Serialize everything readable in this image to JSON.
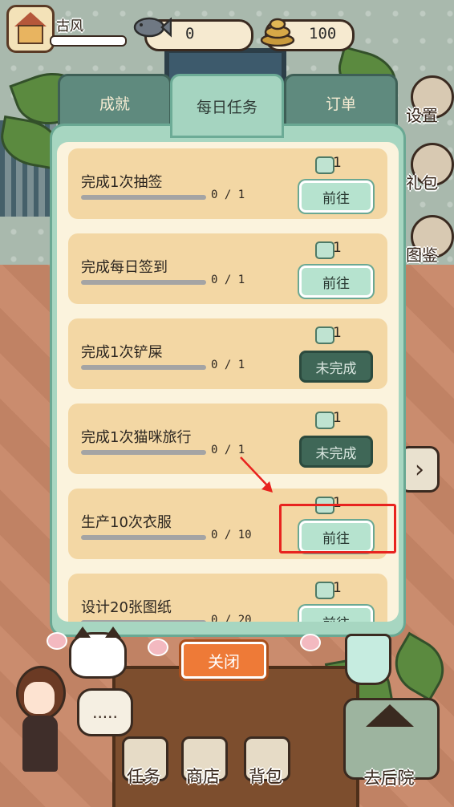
{
  "hud": {
    "player_name": "古风",
    "fish_count": "0",
    "coin_count": "100",
    "fish_icon": "fish-icon",
    "coin_icon": "poop-coin-icon"
  },
  "side_menu": {
    "settings": "设置",
    "gift": "礼包",
    "collection": "图鉴",
    "next_icon": "chevron-right-icon"
  },
  "tabs": [
    {
      "label": "成就",
      "active": false
    },
    {
      "label": "每日任务",
      "active": true
    },
    {
      "label": "订单",
      "active": false
    }
  ],
  "tasks": [
    {
      "title": "完成1次抽签",
      "progress": "0 / 1",
      "reward": "1",
      "button": "前往",
      "state": "go"
    },
    {
      "title": "完成每日签到",
      "progress": "0 / 1",
      "reward": "1",
      "button": "前往",
      "state": "go"
    },
    {
      "title": "完成1次铲屎",
      "progress": "0 / 1",
      "reward": "1",
      "button": "未完成",
      "state": "incomplete"
    },
    {
      "title": "完成1次猫咪旅行",
      "progress": "0 / 1",
      "reward": "1",
      "button": "未完成",
      "state": "incomplete"
    },
    {
      "title": "生产10次衣服",
      "progress": "0 / 10",
      "reward": "1",
      "button": "前往",
      "state": "go"
    },
    {
      "title": "设计20张图纸",
      "progress": "0 / 20",
      "reward": "1",
      "button": "前往",
      "state": "go"
    }
  ],
  "close_label": "关闭",
  "chat_label": ".....",
  "bottom_menu": {
    "tasks": "任务",
    "shop": "商店",
    "bag": "背包",
    "home": "去后院"
  },
  "colors": {
    "panel": "#a7d6c1",
    "highlight": "#e8231f",
    "close_button": "#ee7a37"
  }
}
